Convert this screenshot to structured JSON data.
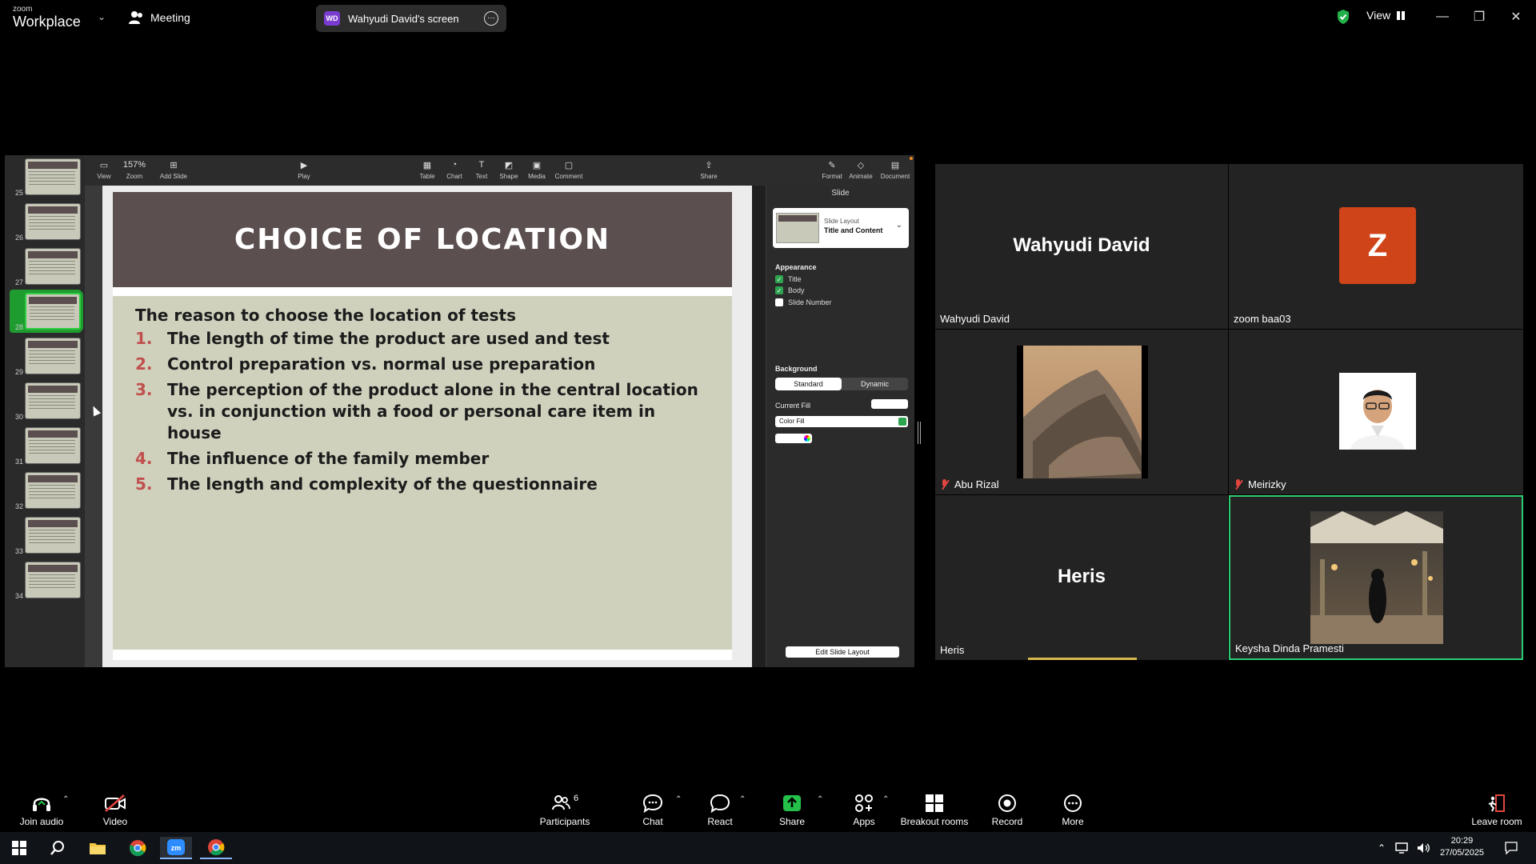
{
  "topbar": {
    "brand_line1": "zoom",
    "brand_line2": "Workplace",
    "meeting_label": "Meeting",
    "screen_avatar": "WD",
    "screen_label": "Wahyudi David's screen",
    "view_label": "View"
  },
  "presentation": {
    "thumb_numbers": [
      "25",
      "26",
      "27",
      "28",
      "29",
      "30",
      "31",
      "32",
      "33",
      "34"
    ],
    "selected_slide": "28",
    "toolbar": {
      "view": "View",
      "zoom_value": "157%",
      "zoom": "Zoom",
      "add_slide": "Add Slide",
      "play": "Play",
      "table": "Table",
      "chart": "Chart",
      "text": "Text",
      "shape": "Shape",
      "media": "Media",
      "comment": "Comment",
      "share": "Share",
      "format": "Format",
      "animate": "Animate",
      "document": "Document"
    },
    "slide": {
      "title": "CHOICE OF LOCATION",
      "intro": "The reason to choose the location of tests",
      "items": [
        {
          "n": "1.",
          "text": "The length of time the product are used and test"
        },
        {
          "n": "2.",
          "text": "Control preparation vs. normal use preparation"
        },
        {
          "n": "3.",
          "text": "The perception of the product alone in the central location vs. in conjunction with a food or personal care item in house"
        },
        {
          "n": "4.",
          "text": "The influence of the family member"
        },
        {
          "n": "5.",
          "text": "The length and complexity of the questionnaire"
        }
      ]
    },
    "panel": {
      "header": "Slide",
      "layout_key": "Slide Layout",
      "layout_value": "Title and Content",
      "appearance": "Appearance",
      "chk_title": "Title",
      "chk_body": "Body",
      "chk_slide_number": "Slide Number",
      "background": "Background",
      "seg_standard": "Standard",
      "seg_dynamic": "Dynamic",
      "current_fill": "Current Fill",
      "color_fill": "Color Fill",
      "edit_layout": "Edit Slide Layout"
    }
  },
  "participants": [
    {
      "display": "Wahyudi David",
      "name": "Wahyudi David"
    },
    {
      "display": "Z",
      "name": "zoom baa03",
      "avatar_color": "#d04419"
    },
    {
      "name": "Abu Rizal",
      "muted": true
    },
    {
      "name": "Meirizky",
      "muted": true
    },
    {
      "display": "Heris",
      "name": "Heris"
    },
    {
      "name": "Keysha Dinda Pramesti",
      "active_speaker": true
    }
  ],
  "bottombar": {
    "join_audio": "Join audio",
    "video": "Video",
    "participants": "Participants",
    "participants_count": "6",
    "chat": "Chat",
    "react": "React",
    "share": "Share",
    "apps": "Apps",
    "breakout": "Breakout rooms",
    "record": "Record",
    "more": "More",
    "leave": "Leave room"
  },
  "taskbar": {
    "time": "20:29",
    "date": "27/05/2025"
  },
  "colors": {
    "share_green": "#25c04a",
    "active_border": "#2ecc71",
    "title_bg": "#5b4f4f",
    "body_bg": "#d0d1bd",
    "number_red": "#c0504d"
  }
}
